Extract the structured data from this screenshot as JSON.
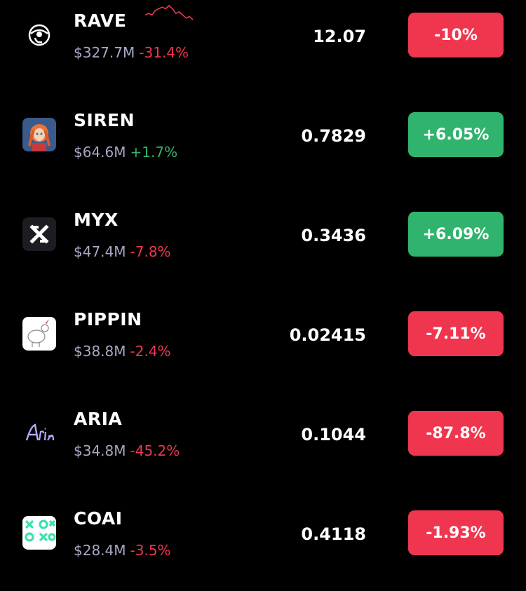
{
  "rows": [
    {
      "symbol": "RAVE",
      "market_cap": "$327.7M",
      "change": "-31.4%",
      "price": "12.07",
      "badge": "-10%",
      "direction": "neg",
      "logo": "rave-eye-logo-icon"
    },
    {
      "symbol": "SIREN",
      "market_cap": "$64.6M",
      "change": "+1.7%",
      "price": "0.7829",
      "badge": "+6.05%",
      "direction": "pos",
      "logo": "siren-avatar-logo-icon"
    },
    {
      "symbol": "MYX",
      "market_cap": "$47.4M",
      "change": "-7.8%",
      "price": "0.3436",
      "badge": "+6.09%",
      "direction": "pos",
      "logo": "myx-x-logo-icon"
    },
    {
      "symbol": "PIPPIN",
      "market_cap": "$38.8M",
      "change": "-2.4%",
      "price": "0.02415",
      "badge": "-7.11%",
      "direction": "neg",
      "logo": "pippin-unicorn-logo-icon"
    },
    {
      "symbol": "ARIA",
      "market_cap": "$34.8M",
      "change": "-45.2%",
      "price": "0.1044",
      "badge": "-87.8%",
      "direction": "neg",
      "logo": "aria-script-logo-icon"
    },
    {
      "symbol": "COAI",
      "market_cap": "$28.4M",
      "change": "-3.5%",
      "price": "0.4118",
      "badge": "-1.93%",
      "direction": "neg",
      "logo": "coai-xoxo-logo-icon"
    }
  ],
  "colors": {
    "negative": "#f0364f",
    "positive": "#30b46d",
    "muted": "#a7a9c4"
  },
  "rave_sparkline": [
    6,
    5,
    6,
    3,
    2,
    1,
    2,
    0,
    2,
    5,
    4,
    6,
    8,
    7,
    9
  ]
}
